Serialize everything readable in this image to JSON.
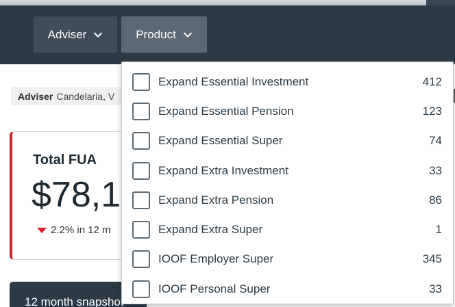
{
  "nav": {
    "adviser_label": "Adviser",
    "product_label": "Product"
  },
  "filter": {
    "key": "Adviser",
    "value": "Candelaria, V"
  },
  "fua_card": {
    "title": "Total FUA",
    "value": "$78,1",
    "trend": "2.2% in 12 m"
  },
  "snapshot": {
    "title": "12 month snapshot"
  },
  "product_dropdown": {
    "options": [
      {
        "label": "Expand Essential Investment",
        "count": "412"
      },
      {
        "label": "Expand Essential Pension",
        "count": "123"
      },
      {
        "label": "Expand Essential Super",
        "count": "74"
      },
      {
        "label": "Expand Extra Investment",
        "count": "33"
      },
      {
        "label": "Expand Extra Pension",
        "count": "86"
      },
      {
        "label": "Expand Extra Super",
        "count": "1"
      },
      {
        "label": "IOOF Employer Super",
        "count": "345"
      },
      {
        "label": "IOOF Personal Super",
        "count": "33"
      }
    ]
  },
  "colors": {
    "navbar": "#2b3a45",
    "accent_red": "#d2232a"
  }
}
